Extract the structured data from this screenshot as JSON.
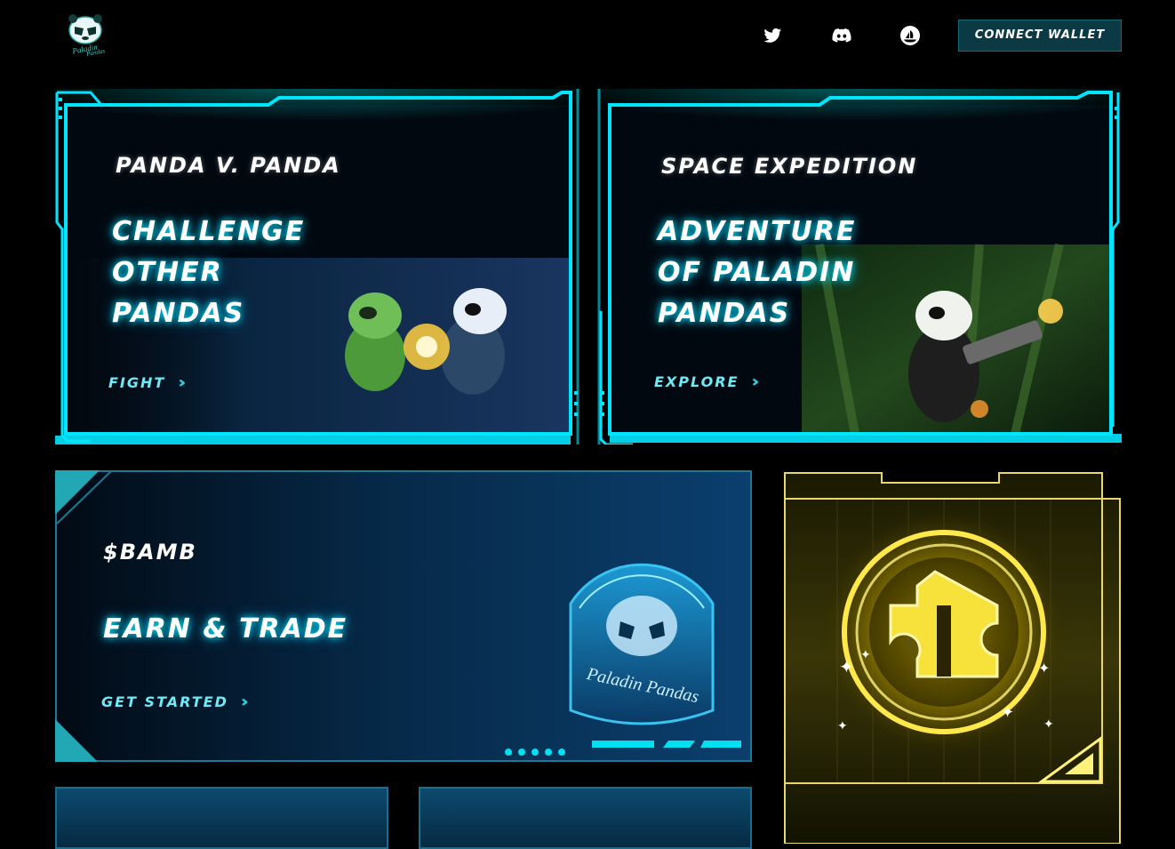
{
  "header": {
    "logo_text_top": "Paladin",
    "logo_text_bottom": "Pandas",
    "social": [
      {
        "name": "twitter-icon"
      },
      {
        "name": "discord-icon"
      },
      {
        "name": "opensea-icon"
      }
    ],
    "connect_label": "CONNECT WALLET"
  },
  "cards": {
    "pvp": {
      "title": "PANDA V. PANDA",
      "headline": [
        "CHALLENGE",
        "OTHER",
        "PANDAS"
      ],
      "cta": "FIGHT"
    },
    "space": {
      "title": "SPACE EXPEDITION",
      "headline": [
        "ADVENTURE",
        "OF PALADIN",
        "PANDAS"
      ],
      "cta": "EXPLORE"
    },
    "bamb": {
      "title": "$BAMB",
      "headline": "EARN & TRADE",
      "cta": "GET STARTED",
      "badge_text": "Paladin Pandas"
    }
  },
  "colors": {
    "accent": "#00e5ff",
    "gold": "#ffe84a",
    "panel_dark": "#041c2e"
  }
}
